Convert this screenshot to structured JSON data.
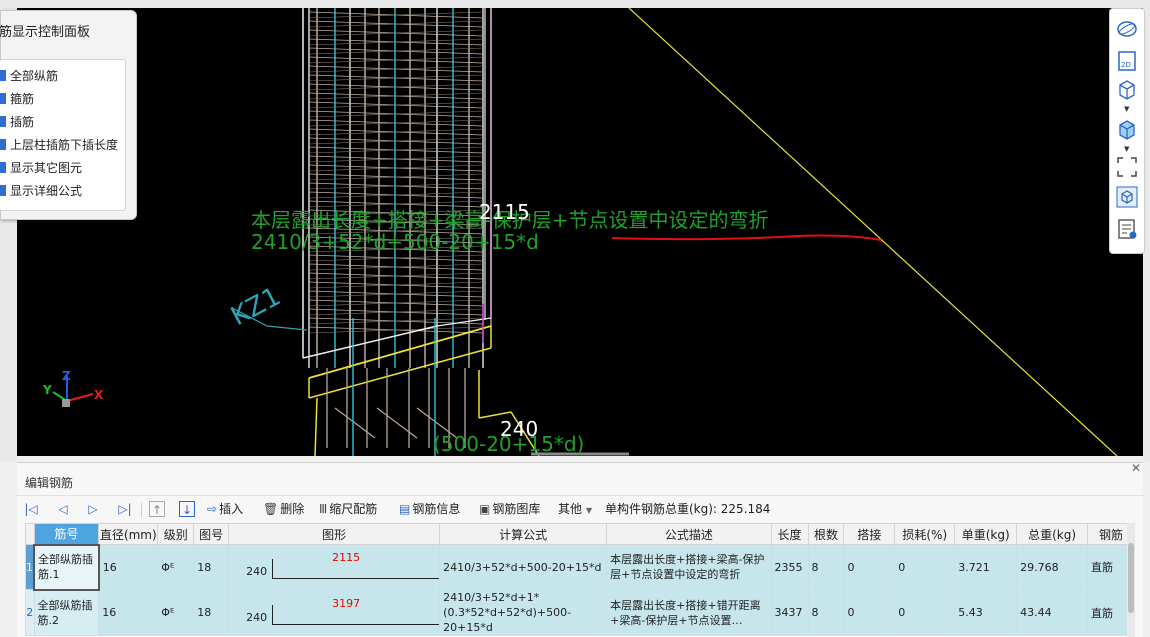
{
  "control_panel": {
    "title": "筋显示控制面板",
    "options": [
      "全部纵筋",
      "箍筋",
      "插筋",
      "上层柱插筋下插长度",
      "显示其它图元",
      "显示详细公式"
    ]
  },
  "viewport": {
    "formula_desc": "本层露出长度+搭接+梁高-保护层+节点设置中设定的弯折",
    "formula_expr": "2410/3+52*d+500-20+15*d",
    "label_2115": "2115",
    "label_240": "240",
    "label_bottom": "(500-20+15*d)",
    "element_label": "KZ1",
    "axes": {
      "x": "X",
      "y": "Y",
      "z": "Z"
    }
  },
  "right_tools": [
    "orbit-icon",
    "view-2d-icon",
    "view-3d-box-icon",
    "solid-box-icon",
    "fit-view-icon",
    "element-view-icon",
    "rebar-list-icon"
  ],
  "edit_panel": {
    "title": "编辑钢筋",
    "toolbar": {
      "insert": "插入",
      "delete": "删除",
      "scale_rebar": "缩尺配筋",
      "rebar_info": "钢筋信息",
      "rebar_library": "钢筋图库",
      "other": "其他",
      "total_weight": "单构件钢筋总重(kg): 225.184"
    },
    "columns": [
      "筋号",
      "直径(mm)",
      "级别",
      "图号",
      "图形",
      "计算公式",
      "公式描述",
      "长度",
      "根数",
      "搭接",
      "损耗(%)",
      "单重(kg)",
      "总重(kg)",
      "钢筋"
    ],
    "rows": [
      {
        "no": "1",
        "name": "全部纵筋插筋.1",
        "diameter": "16",
        "grade": "Φᴱ",
        "fig": "18",
        "shape_left": "240",
        "shape_mid": "2115",
        "formula": "2410/3+52*d+500-20+15*d",
        "desc": "本层露出长度+搭接+梁高-保护层+节点设置中设定的弯折",
        "length": "2355",
        "count": "8",
        "lap": "0",
        "loss": "0",
        "unit_w": "3.721",
        "total_w": "29.768",
        "type": "直筋"
      },
      {
        "no": "2",
        "name": "全部纵筋插筋.2",
        "diameter": "16",
        "grade": "Φᴱ",
        "fig": "18",
        "shape_left": "240",
        "shape_mid": "3197",
        "formula": "2410/3+52*d+1*(0.3*52*d+52*d)+500-20+15*d",
        "desc": "本层露出长度+搭接+错开距离+梁高-保护层+节点设置…",
        "length": "3437",
        "count": "8",
        "lap": "0",
        "loss": "0",
        "unit_w": "5.43",
        "total_w": "43.44",
        "type": "直筋"
      }
    ]
  }
}
